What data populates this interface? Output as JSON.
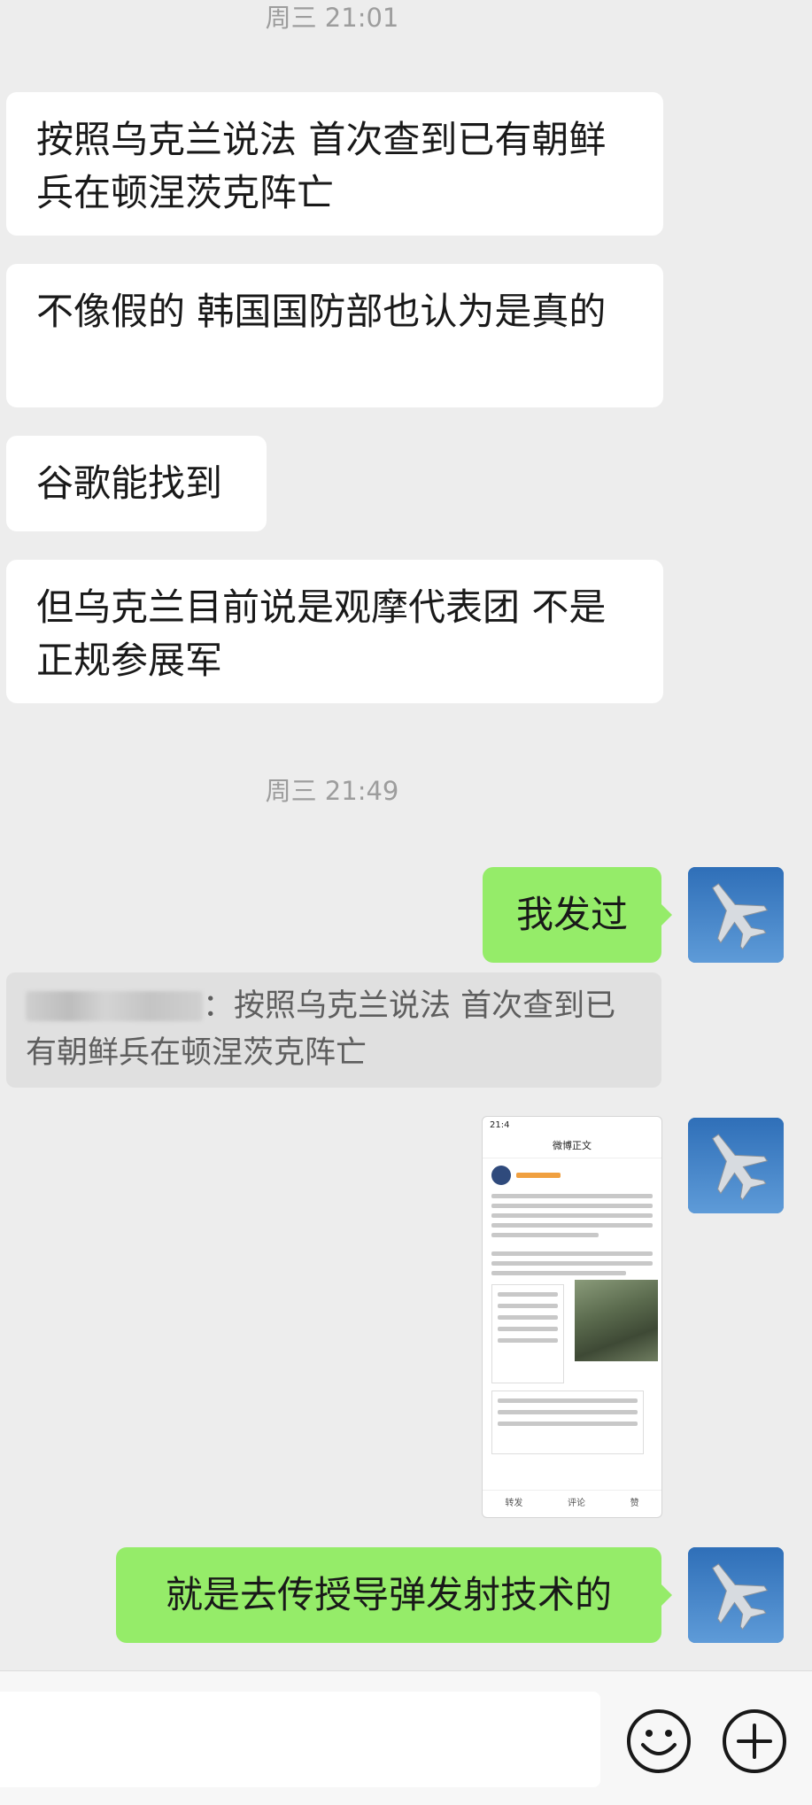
{
  "chat": {
    "timestamps": [
      "周三 21:01",
      "周三 21:49"
    ],
    "incoming": [
      "按照乌克兰说法 首次查到已有朝鲜兵在顿涅茨克阵亡",
      "不像假的 韩国国防部也认为是真的",
      "谷歌能找到",
      "但乌克兰目前说是观摩代表团 不是正规参展军"
    ],
    "outgoing": [
      "我发过",
      "就是去传授导弹发射技术的"
    ],
    "quote": {
      "text": "：按照乌克兰说法 首次查到已有朝鲜兵在顿涅茨克阵亡"
    },
    "image_thumb": {
      "status_time": "21:4",
      "nav_title": "微博正文",
      "footer": [
        "转发",
        "评论",
        "赞"
      ]
    }
  },
  "input_bar": {
    "emoji_icon": "emoji-icon",
    "plus_icon": "plus-icon"
  },
  "colors": {
    "background": "#ededed",
    "outgoing_bubble": "#95ec69",
    "incoming_bubble": "#ffffff"
  }
}
